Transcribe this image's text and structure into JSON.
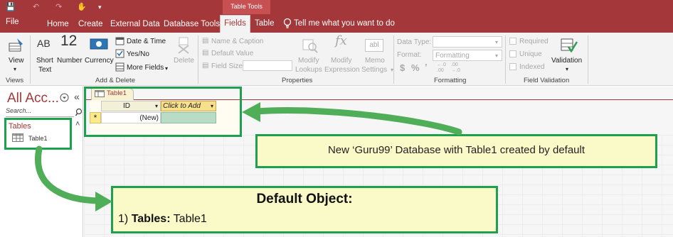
{
  "title_bar": {
    "contextual_tab_group": "Table Tools"
  },
  "ribbon_tabs": {
    "file": "File",
    "home": "Home",
    "create": "Create",
    "external_data": "External Data",
    "database_tools": "Database Tools",
    "fields": "Fields",
    "table": "Table",
    "tell_me": "Tell me what you want to do"
  },
  "ribbon": {
    "views_group": {
      "label": "Views",
      "view_button": "View"
    },
    "add_delete_group": {
      "label": "Add & Delete",
      "short_text_glyph": "AB",
      "short_text_label_1": "Short",
      "short_text_label_2": "Text",
      "number_glyph": "12",
      "number_label": "Number",
      "currency_label": "Currency",
      "date_time": "Date & Time",
      "yes_no": "Yes/No",
      "more_fields": "More Fields",
      "delete": "Delete"
    },
    "properties_group": {
      "label": "Properties",
      "name_caption": "Name & Caption",
      "default_value": "Default Value",
      "field_size": "Field Size",
      "modify_lookups_1": "Modify",
      "modify_lookups_2": "Lookups",
      "modify_expression_1": "Modify",
      "modify_expression_2": "Expression",
      "memo_settings_1": "Memo",
      "memo_settings_2": "Settings"
    },
    "formatting_group": {
      "label": "Formatting",
      "data_type_label": "Data Type:",
      "format_label": "Format:",
      "format_value": "Formatting",
      "currency_symbol": "$",
      "percent_symbol": "%",
      "comma_symbol": "’"
    },
    "field_validation_group": {
      "label": "Field Validation",
      "required": "Required",
      "unique": "Unique",
      "indexed": "Indexed",
      "validation": "Validation"
    }
  },
  "nav_pane": {
    "title": "All Acc...",
    "search_placeholder": "Search...",
    "section_title": "Tables",
    "items": [
      {
        "label": "Table1"
      }
    ]
  },
  "document": {
    "tab_label": "Table1",
    "columns": [
      {
        "label": "ID"
      },
      {
        "label": "Click to Add"
      }
    ],
    "new_row_marker": "*",
    "new_row_value": "(New)"
  },
  "annotations": {
    "callout_top": "New ‘Guru99’ Database with Table1 created by default",
    "callout_bottom_title": "Default Object:",
    "callout_bottom_prefix": "1)",
    "callout_bottom_bold": "Tables:",
    "callout_bottom_value": "Table1"
  },
  "colors": {
    "accent": "#a4373a",
    "callout_border": "#1ea14f",
    "callout_fill": "#fafac8"
  }
}
